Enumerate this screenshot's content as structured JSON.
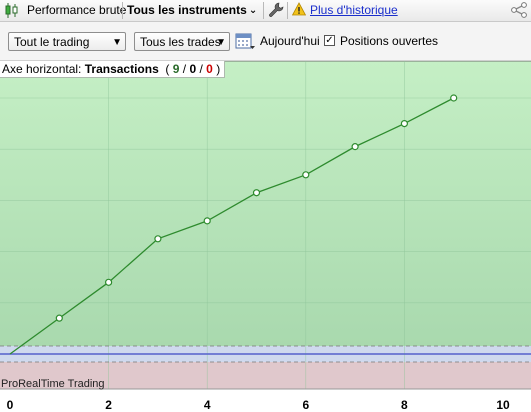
{
  "toolbar": {
    "perf_label": "Performance brute",
    "instruments_label": "Tous les instruments",
    "history_link": "Plus d'historique"
  },
  "filters": {
    "trading_select": "Tout le trading",
    "trades_select": "Tous les trades",
    "today_label": "Aujourd'hui",
    "open_positions_label": "Positions ouvertes",
    "open_positions_checked": true
  },
  "axis_header": {
    "prefix": "Axe horizontal:",
    "mode": "Transactions",
    "count_a": "9",
    "count_b": "0",
    "count_c": "0"
  },
  "watermark": "ProRealTime Trading",
  "colors": {
    "gain_zone": "#b2e0b2",
    "loss_zone": "#e0c8cc",
    "equity_line": "#2e8b2e",
    "baseline": "#5561cc",
    "toolbar_link": "#1a2ecc"
  },
  "chart_data": {
    "type": "line",
    "x": [
      0,
      1,
      2,
      3,
      4,
      5,
      6,
      7,
      8,
      9
    ],
    "series": [
      {
        "values": [
          0,
          14,
          28,
          45,
          52,
          63,
          70,
          81,
          90,
          100
        ]
      }
    ],
    "xlim": [
      0,
      10
    ],
    "x_ticks": [
      "0",
      "2",
      "4",
      "6",
      "8",
      "10"
    ],
    "grid": true
  }
}
